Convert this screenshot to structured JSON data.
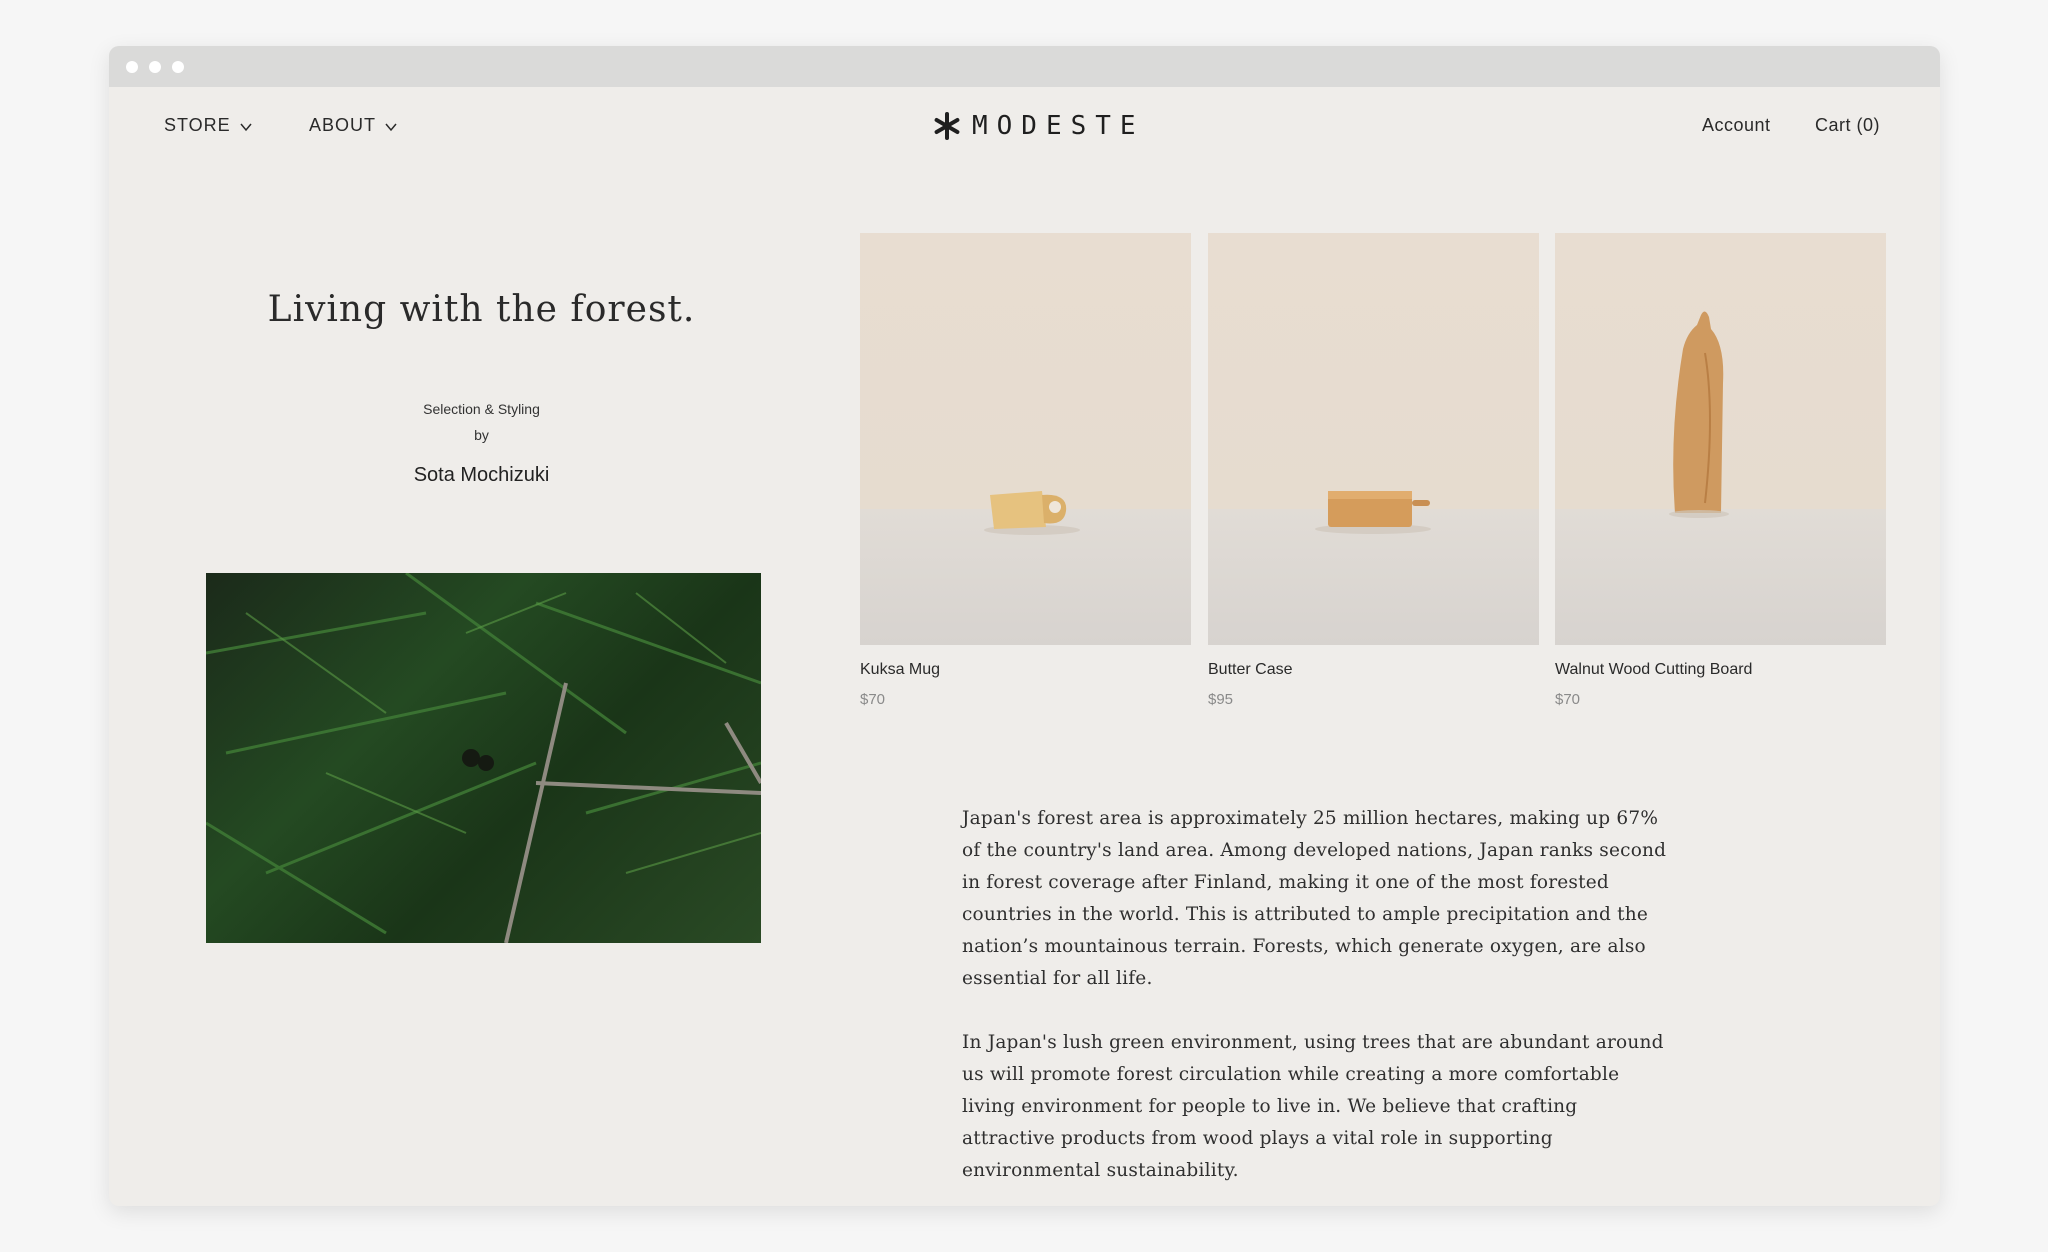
{
  "nav": {
    "store_label": "STORE",
    "about_label": "ABOUT",
    "logo_text": "MODESTE",
    "account_label": "Account",
    "cart_label": "Cart (0)"
  },
  "hero": {
    "headline": "Living with the forest.",
    "credit_label": "Selection & Styling",
    "credit_by": "by",
    "author": "Sota Mochizuki"
  },
  "products": [
    {
      "name": "Kuksa Mug",
      "price": "$70",
      "icon": "mug"
    },
    {
      "name": "Butter Case",
      "price": "$95",
      "icon": "butter-case"
    },
    {
      "name": "Walnut Wood Cutting Board",
      "price": "$70",
      "icon": "cutting-board"
    }
  ],
  "article": {
    "paragraph_1": "Japan's forest area is approximately 25 million hectares, making up 67% of the country's land area. Among developed nations, Japan ranks second in forest coverage after Finland, making it one of the most forested countries in the world. This is attributed to ample precipitation and the nation’s mountainous terrain. Forests, which generate oxygen, are also essential for all life.",
    "paragraph_2": "In Japan's lush green environment, using trees that are abundant around us will promote forest circulation while creating a more comfortable living environment for people to live in. We believe that crafting attractive products from wood plays a vital role in supporting environmental sustainability."
  },
  "colors": {
    "page_bg": "#efedea",
    "titlebar": "#dadad9",
    "price_text": "#8a8a8a",
    "wood": "#d9a463"
  }
}
